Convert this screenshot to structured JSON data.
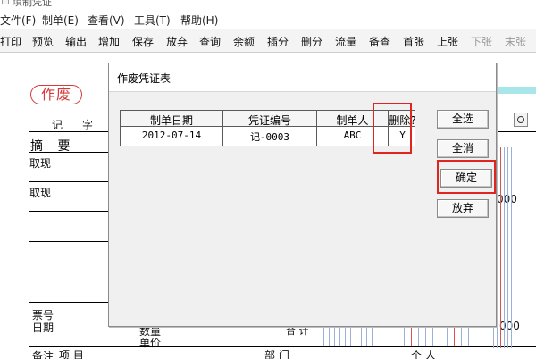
{
  "window": {
    "title": "填制凭证"
  },
  "menu": [
    {
      "label": "文件(F)"
    },
    {
      "label": "制单(E)"
    },
    {
      "label": "查看(V)"
    },
    {
      "label": "工具(T)"
    },
    {
      "label": "帮助(H)"
    }
  ],
  "toolbar": [
    {
      "label": "打印",
      "disabled": false
    },
    {
      "label": "预览",
      "disabled": false
    },
    {
      "label": "输出",
      "disabled": false
    },
    {
      "label": "增加",
      "disabled": false
    },
    {
      "label": "保存",
      "disabled": false
    },
    {
      "label": "放弃",
      "disabled": false
    },
    {
      "label": "查询",
      "disabled": false
    },
    {
      "label": "余额",
      "disabled": false
    },
    {
      "label": "插分",
      "disabled": false
    },
    {
      "label": "删分",
      "disabled": false
    },
    {
      "label": "流量",
      "disabled": false
    },
    {
      "label": "备查",
      "disabled": false
    },
    {
      "label": "首张",
      "disabled": false
    },
    {
      "label": "上张",
      "disabled": false
    },
    {
      "label": "下张",
      "disabled": true
    },
    {
      "label": "末张",
      "disabled": true
    }
  ],
  "voucher": {
    "void_stamp": "作废",
    "word_ji": "记",
    "word_zi": "字",
    "summary_header": "摘 要",
    "rows": [
      "取现",
      "取现"
    ],
    "ticket_no_label": "票号",
    "date_label": "日期",
    "quantity_label": "数量",
    "unit_price_label": "单价",
    "total_label": "合 计",
    "project_label": "项 目",
    "department_label": "部 门",
    "person_label": "个 人",
    "note_label": "备注",
    "amount_partial": "000",
    "amount_partial_2": "000"
  },
  "dialog": {
    "title": "作废凭证表",
    "columns": [
      "制单日期",
      "凭证编号",
      "制单人",
      "删除?"
    ],
    "rows": [
      {
        "date": "2012-07-14",
        "voucher_no": "记-0003",
        "maker": "ABC",
        "delete": "Y"
      }
    ],
    "buttons": {
      "select_all": "全选",
      "clear_all": "全消",
      "confirm": "确定",
      "cancel": "放弃"
    }
  },
  "highlight_color": "#e0241f"
}
